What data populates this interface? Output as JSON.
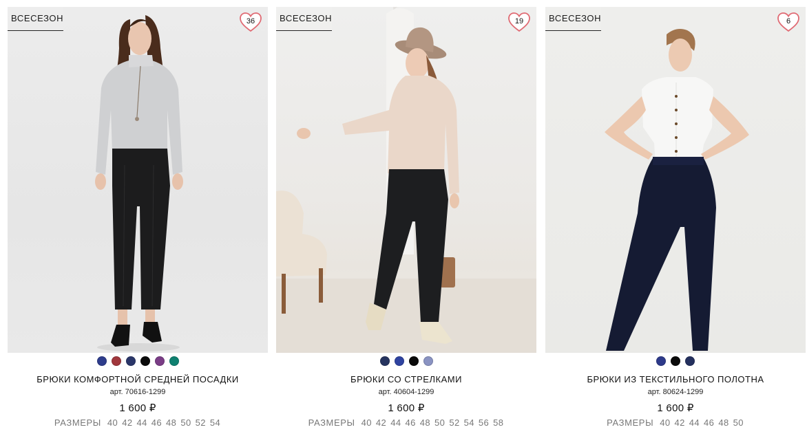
{
  "products": [
    {
      "tag": "ВСЕСЕЗОН",
      "favorites": "36",
      "colors": [
        "#2e3d8c",
        "#a0373c",
        "#2a3669",
        "#0a0a0a",
        "#7a3d86",
        "#0f8070"
      ],
      "title": "БРЮКИ КОМФОРТНОЙ СРЕДНЕЙ ПОСАДКИ",
      "article": "арт. 70616-1299",
      "price": "1 600 ₽",
      "sizes_label": "РАЗМЕРЫ",
      "sizes": [
        "40",
        "42",
        "44",
        "46",
        "48",
        "50",
        "52",
        "54"
      ]
    },
    {
      "tag": "ВСЕСЕЗОН",
      "favorites": "19",
      "colors": [
        "#26345f",
        "#2f43a0",
        "#0a0a0a",
        "#8a93c2"
      ],
      "title": "БРЮКИ СО СТРЕЛКАМИ",
      "article": "арт. 40604-1299",
      "price": "1 600 ₽",
      "sizes_label": "РАЗМЕРЫ",
      "sizes": [
        "40",
        "42",
        "44",
        "46",
        "48",
        "50",
        "52",
        "54",
        "56",
        "58"
      ]
    },
    {
      "tag": "ВСЕСЕЗОН",
      "favorites": "6",
      "colors": [
        "#2d3a8a",
        "#0a0a0a",
        "#24305e"
      ],
      "title": "БРЮКИ ИЗ ТЕКСТИЛЬНОГО ПОЛОТНА",
      "article": "арт. 80624-1299",
      "price": "1 600 ₽",
      "sizes_label": "РАЗМЕРЫ",
      "sizes": [
        "40",
        "42",
        "44",
        "46",
        "48",
        "50"
      ]
    }
  ]
}
